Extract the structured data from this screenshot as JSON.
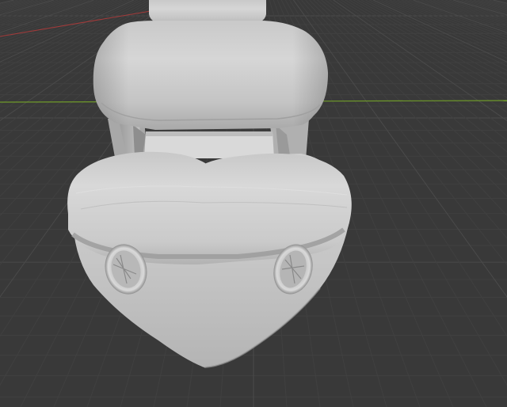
{
  "app": {
    "editor": "3D Viewport",
    "shading": "solid",
    "view": "perspective"
  },
  "colors": {
    "background": "#393939",
    "grid_minor": "#404040",
    "grid_major": "#4a4a4a",
    "x_axis": "#a33a3a",
    "y_axis": "#6f9a2a",
    "mesh_light": "#d2d2d2",
    "mesh_mid": "#bdbdbd",
    "mesh_dark": "#8e8e8e"
  },
  "scene": {
    "object": "boat-hull-mesh",
    "parts": [
      "top-cabin",
      "upper-cabin",
      "pillars",
      "hull-deck-rim",
      "hull",
      "porthole-left",
      "porthole-right"
    ]
  }
}
